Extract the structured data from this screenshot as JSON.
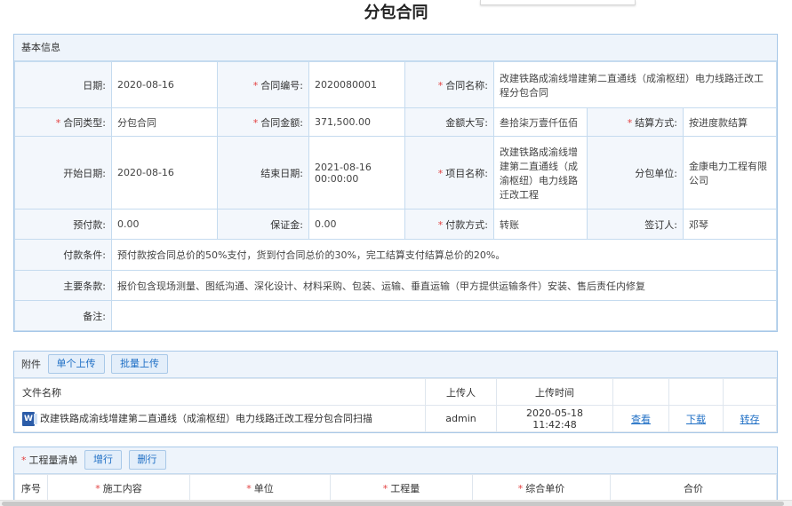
{
  "page": {
    "title": "分包合同"
  },
  "basic": {
    "section_title": "基本信息",
    "date_label": "日期:",
    "date": "2020-08-16",
    "contract_no_label": "合同编号:",
    "contract_no": "2020080001",
    "contract_name_label": "合同名称:",
    "contract_name": "改建铁路成渝线增建第二直通线（成渝枢纽）电力线路迁改工程分包合同",
    "contract_type_label": "合同类型:",
    "contract_type": "分包合同",
    "amount_label": "合同金额:",
    "amount": "371,500.00",
    "amount_cn_label": "金额大写:",
    "amount_cn": "叁拾柒万壹仟伍佰",
    "settlement_label": "结算方式:",
    "settlement": "按进度款结算",
    "start_date_label": "开始日期:",
    "start_date": "2020-08-16",
    "end_date_label": "结束日期:",
    "end_date": "2021-08-16 00:00:00",
    "project_name_label": "项目名称:",
    "project_name": "改建铁路成渝线增建第二直通线（成渝枢纽）电力线路迁改工程",
    "subcontractor_label": "分包单位:",
    "subcontractor": "金康电力工程有限公司",
    "prepay_label": "预付款:",
    "prepay": "0.00",
    "deposit_label": "保证金:",
    "deposit": "0.00",
    "pay_method_label": "付款方式:",
    "pay_method": "转账",
    "signer_label": "签订人:",
    "signer": "邓琴",
    "pay_terms_label": "付款条件:",
    "pay_terms": "预付款按合同总价的50%支付，货到付合同总价的30%，完工结算支付结算总价的20%。",
    "main_terms_label": "主要条款:",
    "main_terms": "报价包含现场测量、图纸沟通、深化设计、材料采购、包装、运输、垂直运输（甲方提供运输条件）安装、售后责任内修复",
    "remark_label": "备注:",
    "remark": ""
  },
  "attachments": {
    "section_title": "附件",
    "upload_single": "单个上传",
    "upload_batch": "批量上传",
    "col_name": "文件名称",
    "col_uploader": "上传人",
    "col_time": "上传时间",
    "files": [
      {
        "icon": "word-icon",
        "name": "改建铁路成渝线增建第二直通线（成渝枢纽）电力线路迁改工程分包合同扫描",
        "uploader": "admin",
        "time": "2020-05-18 11:42:48",
        "view": "查看",
        "download": "下载",
        "transfer": "转存"
      }
    ]
  },
  "quantities": {
    "section_title": "工程量清单",
    "add_row": "增行",
    "del_row": "删行",
    "col_no": "序号",
    "col_content": "施工内容",
    "col_unit": "单位",
    "col_qty": "工程量",
    "col_price": "综合单价",
    "col_total": "合价"
  },
  "colors": {
    "accent": "#1f6fc5",
    "required": "#e34040",
    "border": "#a8c8e8",
    "header_bg": "#eef4fb"
  }
}
